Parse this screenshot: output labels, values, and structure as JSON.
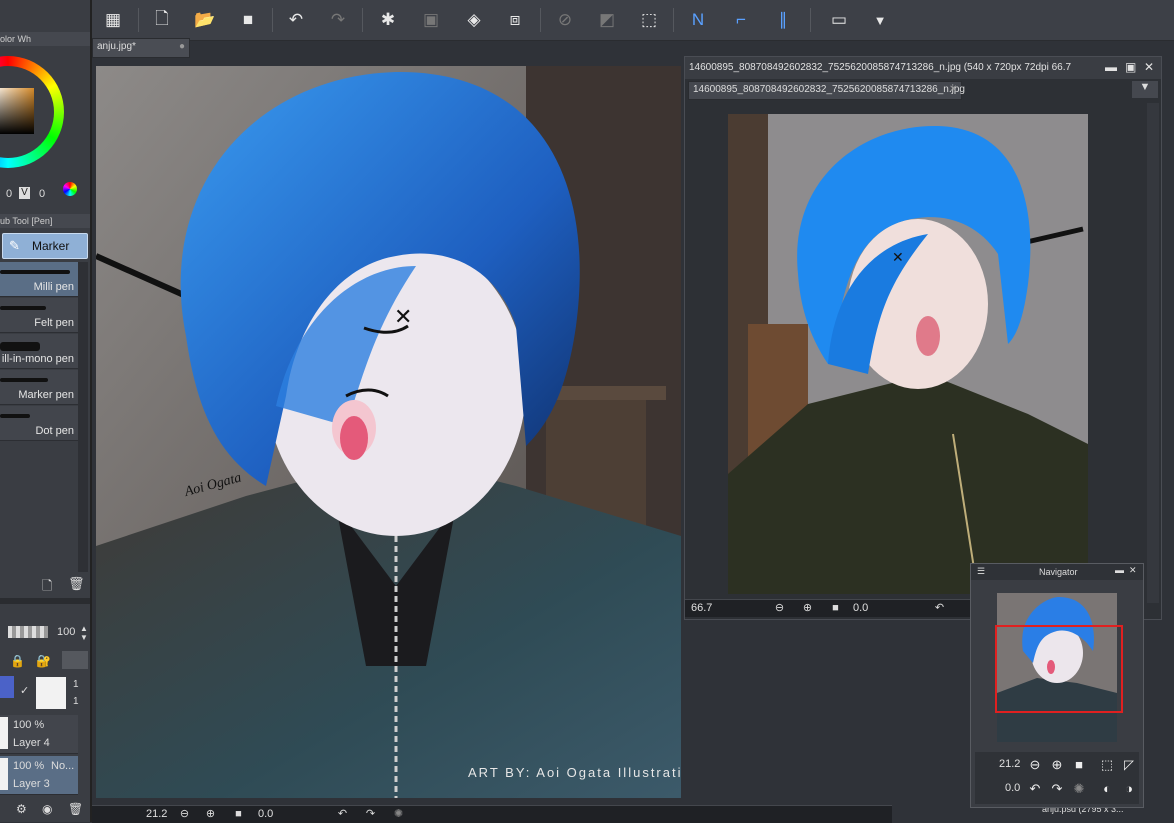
{
  "toolbar": {
    "icons": [
      "grid-icon",
      "new-file-icon",
      "open-folder-icon",
      "save-icon",
      "undo-icon",
      "redo-icon",
      "selection-star-icon",
      "clear-layer-icon",
      "fill-icon",
      "transform-icon",
      "hide-selection-icon",
      "invert-selection-icon",
      "select-all-icon",
      "ruler-snap-icon",
      "snap-curve-icon",
      "snap-grid-icon",
      "window-icon",
      "dropdown-icon"
    ]
  },
  "left_panel": {
    "color_wheel_label": "olor Wh",
    "value_left": "0",
    "value_v_label": "V",
    "value_right": "0",
    "sub_tool_header": "ub Tool [Pen]",
    "active_tool": "Marker",
    "brushes": [
      {
        "label": "Milli pen"
      },
      {
        "label": "Felt pen"
      },
      {
        "label": "ill-in-mono pen"
      },
      {
        "label": "Marker pen"
      },
      {
        "label": "Dot pen"
      }
    ],
    "opacity_value": "100",
    "layers": [
      {
        "opacity": "100 %",
        "blend": "",
        "name": "Layer 4"
      },
      {
        "opacity": "100 %",
        "blend": "No...",
        "name": "Layer 3"
      }
    ],
    "layer_side_digits": [
      "1",
      "1"
    ]
  },
  "document": {
    "tab_label": "anju.jpg*",
    "watermark": "ART BY: Aoi Ogata Illustrations",
    "signature": "Aoi Ogata",
    "zoom": "21.2",
    "rotation": "0.0"
  },
  "subview": {
    "title": "14600895_808708492602832_7525620085874713286_n.jpg (540 x 720px 72dpi 66.7",
    "tab_label": "14600895_808708492602832_7525620085874713286_n.jpg",
    "zoom": "66.7",
    "rotation": "0.0"
  },
  "navigator": {
    "title": "Navigator",
    "zoom": "21.2",
    "rotation": "0.0"
  },
  "bottom_right": {
    "file_info": "anju.psd (2795 x 3..."
  },
  "colors": {
    "accent": "#5a6e86",
    "nav_frame": "#e02020",
    "hair": "#2f7fe0"
  }
}
